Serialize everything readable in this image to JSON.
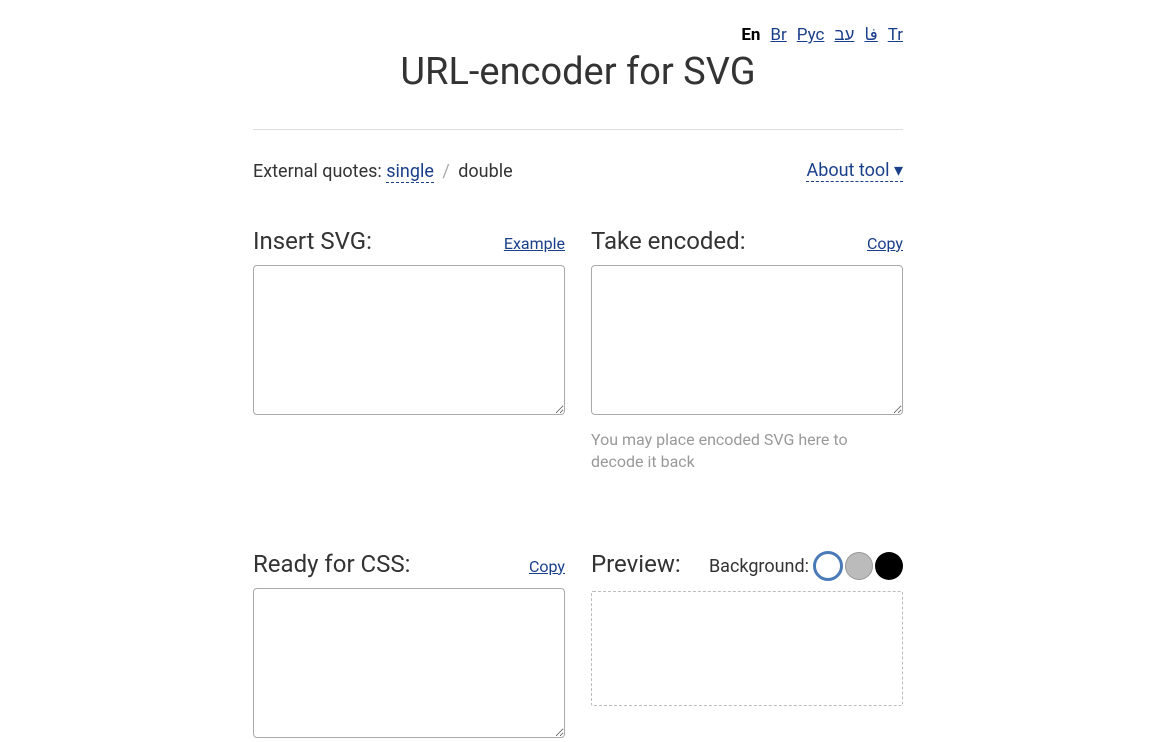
{
  "lang": {
    "en": "En",
    "br": "Br",
    "rus": "Рус",
    "l4": "فا",
    "l5": "עב",
    "tr": "Tr"
  },
  "title": "URL-encoder for SVG",
  "quotes": {
    "label": "External quotes:",
    "single": "single",
    "sep": "/",
    "double": "double"
  },
  "about": "About tool ▾",
  "panels": {
    "insert": {
      "heading": "Insert SVG:",
      "action": "Example"
    },
    "encoded": {
      "heading": "Take encoded:",
      "action": "Copy",
      "hint": "You may place encoded SVG here to decode it back"
    },
    "css": {
      "heading": "Ready for CSS:",
      "action": "Copy"
    },
    "preview": {
      "heading": "Preview:",
      "bgLabel": "Background:"
    }
  }
}
